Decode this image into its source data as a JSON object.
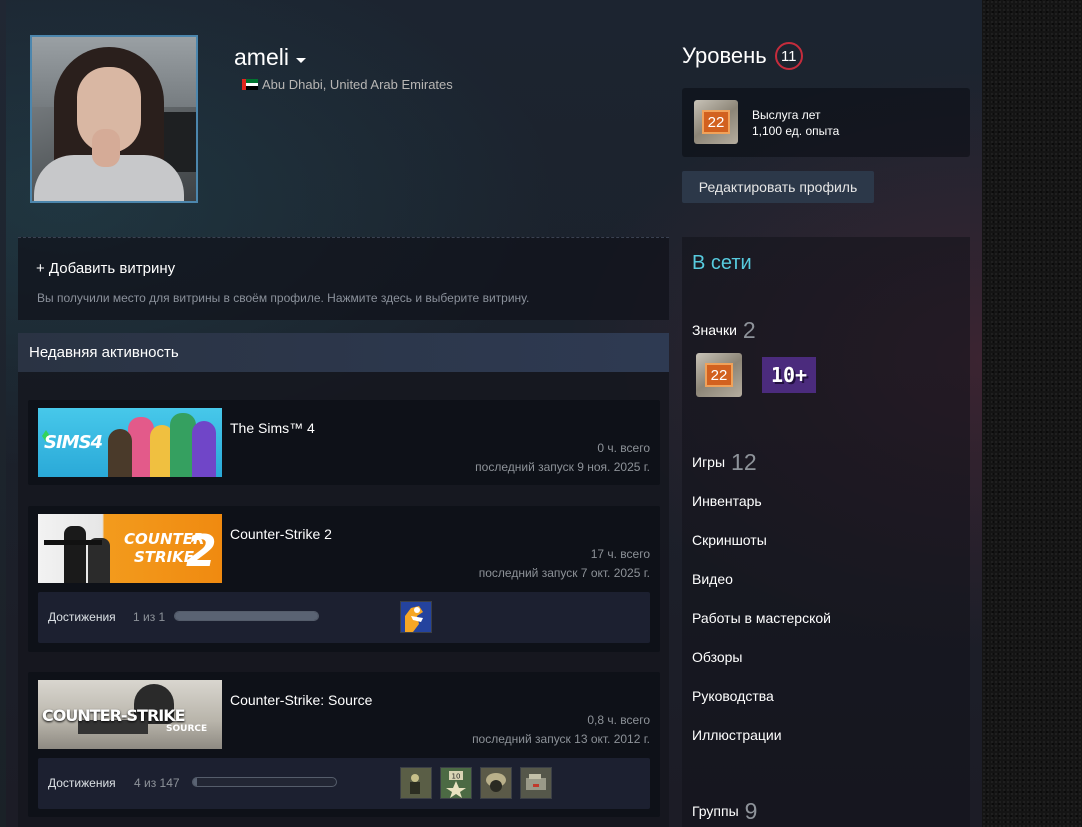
{
  "profile": {
    "username": "ameli",
    "location": "Abu Dhabi, United Arab Emirates",
    "level_label": "Уровень",
    "level": "11",
    "badge": {
      "number": "22",
      "title": "Выслуга лет",
      "xp": "1,100 ед. опыта"
    },
    "edit_label": "Редактировать профиль"
  },
  "showcase": {
    "title": "+ Добавить витрину",
    "description": "Вы получили место для витрины в своём профиле. Нажмите здесь и выберите витрину."
  },
  "activity": {
    "header": "Недавняя активность",
    "games": [
      {
        "name": "The Sims™ 4",
        "hours": "0 ч. всего",
        "last_played": "последний запуск 9 ноя. 2025 г.",
        "image_text": "SIMS4"
      },
      {
        "name": "Counter-Strike 2",
        "hours": "17 ч. всего",
        "last_played": "последний запуск 7 окт. 2025 г.",
        "image_text": {
          "line1": "COUNTER",
          "line2": "STRIKE",
          "big": "2"
        },
        "achievements": {
          "label": "Достижения",
          "count": "1 из 1",
          "progress": 1.0
        }
      },
      {
        "name": "Counter-Strike: Source",
        "hours": "0,8 ч. всего",
        "last_played": "последний запуск 13 окт. 2012 г.",
        "image_text": {
          "logo": "COUNTER-STRIKE",
          "sub": "SOURCE"
        },
        "achievements": {
          "label": "Достижения",
          "count": "4 из 147",
          "progress": 0.027
        }
      }
    ]
  },
  "sidebar": {
    "status": "В сети",
    "badges": {
      "label": "Значки",
      "count": "2",
      "badge_number": "22",
      "badge2_text": "10+"
    },
    "games": {
      "label": "Игры",
      "count": "12"
    },
    "links": [
      "Инвентарь",
      "Скриншоты",
      "Видео",
      "Работы в мастерской",
      "Обзоры",
      "Руководства",
      "Иллюстрации"
    ],
    "groups": {
      "label": "Группы",
      "count": "9"
    }
  },
  "colors": {
    "accent_blue": "#57cbde",
    "level_ring": "#c52c3c",
    "avatar_border": "#4c86ad"
  }
}
